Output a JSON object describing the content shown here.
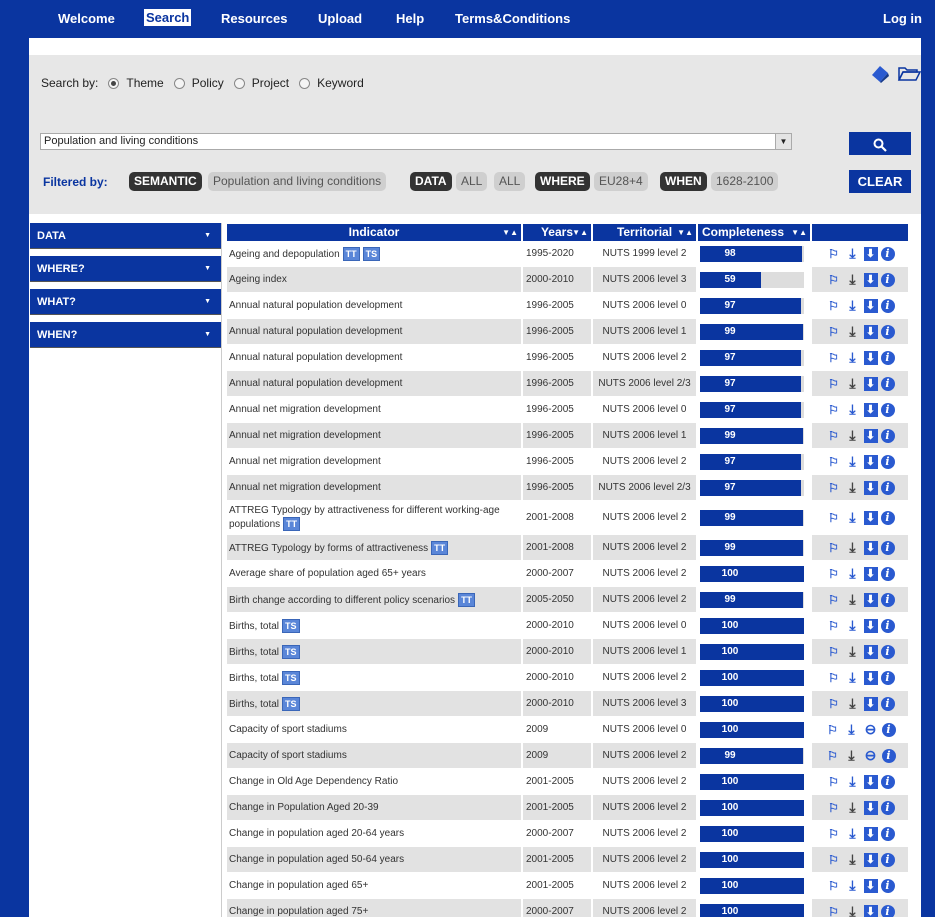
{
  "nav": {
    "items": [
      "Welcome",
      "Search",
      "Resources",
      "Upload",
      "Help",
      "Terms&Conditions"
    ],
    "login": "Log in"
  },
  "search": {
    "label": "Search by:",
    "options": [
      "Theme",
      "Policy",
      "Project",
      "Keyword"
    ],
    "selected": "Theme",
    "select_value": "Population and living conditions",
    "button_icon": "search-icon"
  },
  "filter": {
    "label": "Filtered by:",
    "chips": [
      "SEMANTIC",
      "Population and living conditions",
      "DATA",
      "ALL",
      "ALL",
      "WHERE",
      "EU28+4",
      "WHEN",
      "1628-2100"
    ],
    "clear": "CLEAR"
  },
  "sidebar": {
    "items": [
      "DATA",
      "WHERE?",
      "WHAT?",
      "WHEN?"
    ]
  },
  "table": {
    "headers": [
      "Indicator",
      "Years",
      "Territorial",
      "Completeness"
    ],
    "rows": [
      {
        "indicator": "Ageing and depopulation",
        "tags": [
          "TT",
          "TS"
        ],
        "years": "1995-2020",
        "territorial": "NUTS 1999 level 2",
        "completeness": 98
      },
      {
        "indicator": "Ageing index",
        "tags": [],
        "years": "2000-2010",
        "territorial": "NUTS 2006 level 3",
        "completeness": 59
      },
      {
        "indicator": "Annual natural population development",
        "tags": [],
        "years": "1996-2005",
        "territorial": "NUTS 2006 level 0",
        "completeness": 97
      },
      {
        "indicator": "Annual natural population development",
        "tags": [],
        "years": "1996-2005",
        "territorial": "NUTS 2006 level 1",
        "completeness": 99
      },
      {
        "indicator": "Annual natural population development",
        "tags": [],
        "years": "1996-2005",
        "territorial": "NUTS 2006 level 2",
        "completeness": 97
      },
      {
        "indicator": "Annual natural population development",
        "tags": [],
        "years": "1996-2005",
        "territorial": "NUTS 2006 level 2/3",
        "completeness": 97
      },
      {
        "indicator": "Annual net migration development",
        "tags": [],
        "years": "1996-2005",
        "territorial": "NUTS 2006 level 0",
        "completeness": 97
      },
      {
        "indicator": "Annual net migration development",
        "tags": [],
        "years": "1996-2005",
        "territorial": "NUTS 2006 level 1",
        "completeness": 99
      },
      {
        "indicator": "Annual net migration development",
        "tags": [],
        "years": "1996-2005",
        "territorial": "NUTS 2006 level 2",
        "completeness": 97
      },
      {
        "indicator": "Annual net migration development",
        "tags": [],
        "years": "1996-2005",
        "territorial": "NUTS 2006 level 2/3",
        "completeness": 97
      },
      {
        "indicator": "ATTREG Typology by attractiveness for different working-age populations",
        "tags": [
          "TT"
        ],
        "years": "2001-2008",
        "territorial": "NUTS 2006 level 2",
        "completeness": 99,
        "tall": true
      },
      {
        "indicator": "ATTREG Typology by forms of attractiveness",
        "tags": [
          "TT"
        ],
        "years": "2001-2008",
        "territorial": "NUTS 2006 level 2",
        "completeness": 99
      },
      {
        "indicator": "Average share of population aged 65+ years",
        "tags": [],
        "years": "2000-2007",
        "territorial": "NUTS 2006 level 2",
        "completeness": 100
      },
      {
        "indicator": "Birth change according to different policy scenarios",
        "tags": [
          "TT"
        ],
        "years": "2005-2050",
        "territorial": "NUTS 2006 level 2",
        "completeness": 99
      },
      {
        "indicator": "Births, total",
        "tags": [
          "TS"
        ],
        "years": "2000-2010",
        "territorial": "NUTS 2006 level 0",
        "completeness": 100
      },
      {
        "indicator": "Births, total",
        "tags": [
          "TS"
        ],
        "years": "2000-2010",
        "territorial": "NUTS 2006 level 1",
        "completeness": 100
      },
      {
        "indicator": "Births, total",
        "tags": [
          "TS"
        ],
        "years": "2000-2010",
        "territorial": "NUTS 2006 level 2",
        "completeness": 100
      },
      {
        "indicator": "Births, total",
        "tags": [
          "TS"
        ],
        "years": "2000-2010",
        "territorial": "NUTS 2006 level 3",
        "completeness": 100
      },
      {
        "indicator": "Capacity of sport stadiums",
        "tags": [],
        "years": "2009",
        "territorial": "NUTS 2006 level 0",
        "completeness": 100,
        "locked": true
      },
      {
        "indicator": "Capacity of sport stadiums",
        "tags": [],
        "years": "2009",
        "territorial": "NUTS 2006 level 2",
        "completeness": 99,
        "locked": true
      },
      {
        "indicator": "Change in Old Age Dependency Ratio",
        "tags": [],
        "years": "2001-2005",
        "territorial": "NUTS 2006 level 2",
        "completeness": 100
      },
      {
        "indicator": "Change in Population Aged 20-39",
        "tags": [],
        "years": "2001-2005",
        "territorial": "NUTS 2006 level 2",
        "completeness": 100
      },
      {
        "indicator": "Change in population aged 20-64 years",
        "tags": [],
        "years": "2000-2007",
        "territorial": "NUTS 2006 level 2",
        "completeness": 100
      },
      {
        "indicator": "Change in population aged 50-64 years",
        "tags": [],
        "years": "2001-2005",
        "territorial": "NUTS 2006 level 2",
        "completeness": 100
      },
      {
        "indicator": "Change in population aged 65+",
        "tags": [],
        "years": "2001-2005",
        "territorial": "NUTS 2006 level 2",
        "completeness": 100
      },
      {
        "indicator": "Change in population aged 75+",
        "tags": [],
        "years": "2000-2007",
        "territorial": "NUTS 2006 level 2",
        "completeness": 100
      }
    ]
  },
  "colors": {
    "brand": "#0a35a0",
    "tag": "#5a86d8"
  }
}
